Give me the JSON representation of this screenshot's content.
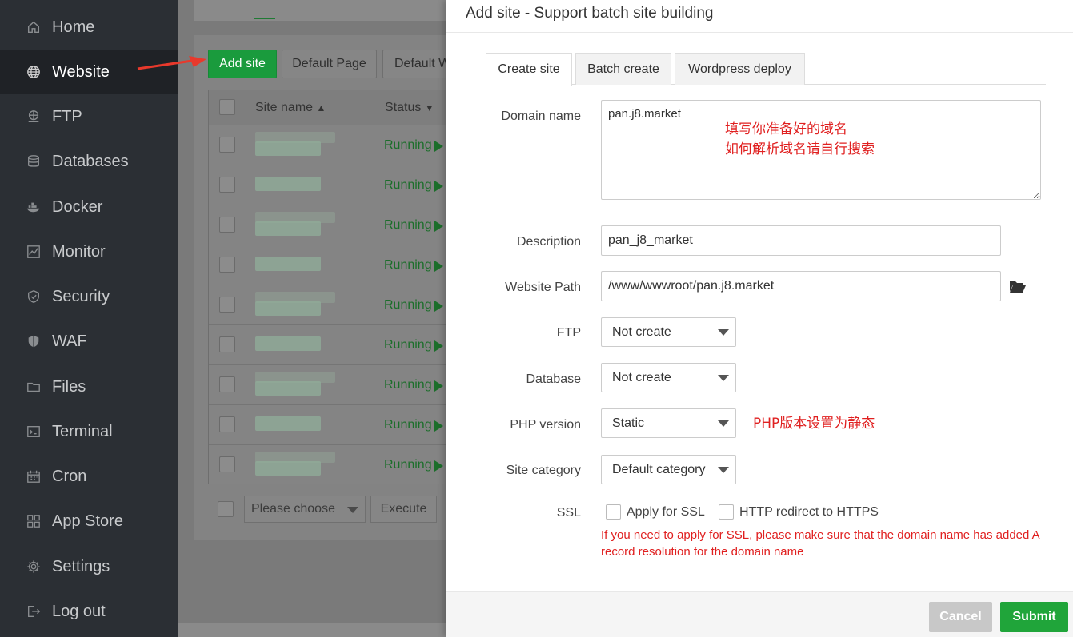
{
  "sidebar": {
    "items": [
      {
        "label": "Home",
        "icon": "home-icon"
      },
      {
        "label": "Website",
        "icon": "globe-icon"
      },
      {
        "label": "FTP",
        "icon": "ftp-icon"
      },
      {
        "label": "Databases",
        "icon": "database-icon"
      },
      {
        "label": "Docker",
        "icon": "docker-icon"
      },
      {
        "label": "Monitor",
        "icon": "monitor-icon"
      },
      {
        "label": "Security",
        "icon": "shield-icon"
      },
      {
        "label": "WAF",
        "icon": "waf-shield-icon"
      },
      {
        "label": "Files",
        "icon": "folder-icon"
      },
      {
        "label": "Terminal",
        "icon": "terminal-icon"
      },
      {
        "label": "Cron",
        "icon": "calendar-icon"
      },
      {
        "label": "App Store",
        "icon": "grid-icon"
      },
      {
        "label": "Settings",
        "icon": "gear-icon"
      },
      {
        "label": "Log out",
        "icon": "logout-icon"
      }
    ],
    "active": "Website"
  },
  "website": {
    "add_site": "Add site",
    "default_page": "Default Page",
    "default_w": "Default W",
    "columns": {
      "site_name": "Site name",
      "status": "Status"
    },
    "rows": [
      {
        "status": "Running"
      },
      {
        "status": "Running"
      },
      {
        "status": "Running"
      },
      {
        "status": "Running"
      },
      {
        "status": "Running"
      },
      {
        "status": "Running"
      },
      {
        "status": "Running"
      },
      {
        "status": "Running"
      },
      {
        "status": "Running"
      }
    ],
    "batch_select_placeholder": "Please choose",
    "execute": "Execute"
  },
  "modal": {
    "title": "Add site - Support batch site building",
    "tabs": [
      "Create site",
      "Batch create",
      "Wordpress deploy"
    ],
    "active_tab": "Create site",
    "fields": {
      "domain_label": "Domain name",
      "domain_value": "pan.j8.market",
      "domain_note_line1": "填写你准备好的域名",
      "domain_note_line2": "如何解析域名请自行搜索",
      "description_label": "Description",
      "description_value": "pan_j8_market",
      "path_label": "Website Path",
      "path_value": "/www/wwwroot/pan.j8.market",
      "ftp_label": "FTP",
      "ftp_value": "Not create",
      "database_label": "Database",
      "database_value": "Not create",
      "php_label": "PHP version",
      "php_value": "Static",
      "php_note": "PHP版本设置为静态",
      "category_label": "Site category",
      "category_value": "Default category",
      "ssl_label": "SSL",
      "apply_ssl": "Apply for SSL",
      "http_redirect": "HTTP redirect to HTTPS",
      "ssl_note": "If you need to apply for SSL, please make sure that the domain name has added A record resolution for the domain name"
    },
    "footer": {
      "cancel": "Cancel",
      "submit": "Submit"
    }
  },
  "colors": {
    "sidebar_bg": "#2b2f34",
    "accent_green": "#20a53a",
    "annotation_red": "#e02020",
    "cancel_grey": "#c8c8c8"
  }
}
